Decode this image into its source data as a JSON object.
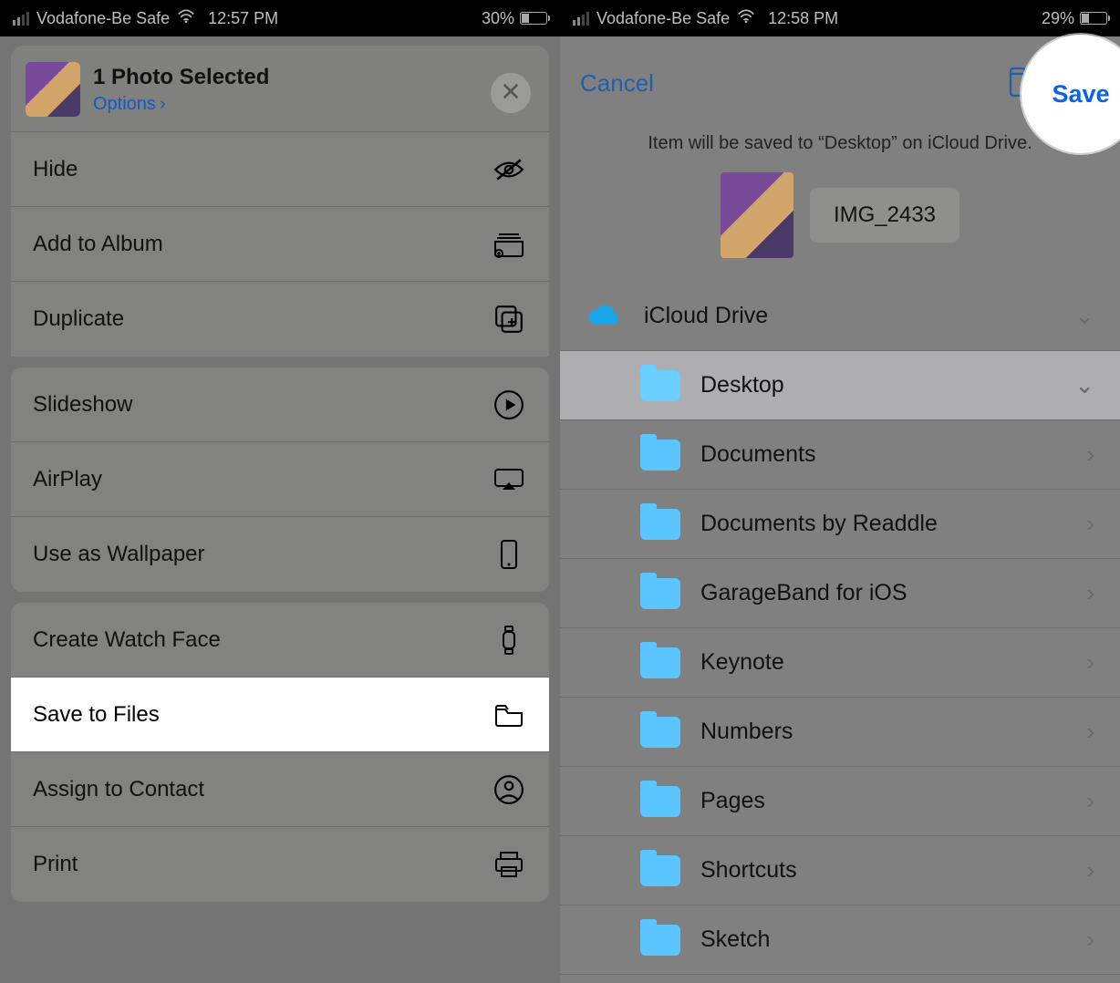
{
  "left": {
    "status": {
      "carrier": "Vodafone-Be Safe",
      "time": "12:57 PM",
      "battery_pct": "30%",
      "battery_fill": 30
    },
    "header": {
      "title": "1 Photo Selected",
      "options": "Options"
    },
    "rows": {
      "hide": "Hide",
      "add_to_album": "Add to Album",
      "duplicate": "Duplicate",
      "slideshow": "Slideshow",
      "airplay": "AirPlay",
      "wallpaper": "Use as Wallpaper",
      "watchface": "Create Watch Face",
      "save_to_files": "Save to Files",
      "assign_contact": "Assign to Contact",
      "print": "Print"
    }
  },
  "right": {
    "status": {
      "carrier": "Vodafone-Be Safe",
      "time": "12:58 PM",
      "battery_pct": "29%",
      "battery_fill": 29
    },
    "nav": {
      "cancel": "Cancel",
      "save": "Save"
    },
    "caption": "Item will be saved to “Desktop” on iCloud Drive.",
    "filename": "IMG_2433",
    "locations": {
      "root": "iCloud Drive",
      "items": [
        {
          "label": "Desktop",
          "selected": true,
          "color": "#6bd0ff"
        },
        {
          "label": "Documents",
          "selected": false,
          "color": "#5bc5ff"
        },
        {
          "label": "Documents by Readdle",
          "selected": false,
          "color": "#5bc5ff"
        },
        {
          "label": "GarageBand for iOS",
          "selected": false,
          "color": "#5bc5ff"
        },
        {
          "label": "Keynote",
          "selected": false,
          "color": "#5bc5ff"
        },
        {
          "label": "Numbers",
          "selected": false,
          "color": "#5bc5ff"
        },
        {
          "label": "Pages",
          "selected": false,
          "color": "#5bc5ff"
        },
        {
          "label": "Shortcuts",
          "selected": false,
          "color": "#5bc5ff"
        },
        {
          "label": "Sketch",
          "selected": false,
          "color": "#5bc5ff"
        }
      ]
    }
  }
}
